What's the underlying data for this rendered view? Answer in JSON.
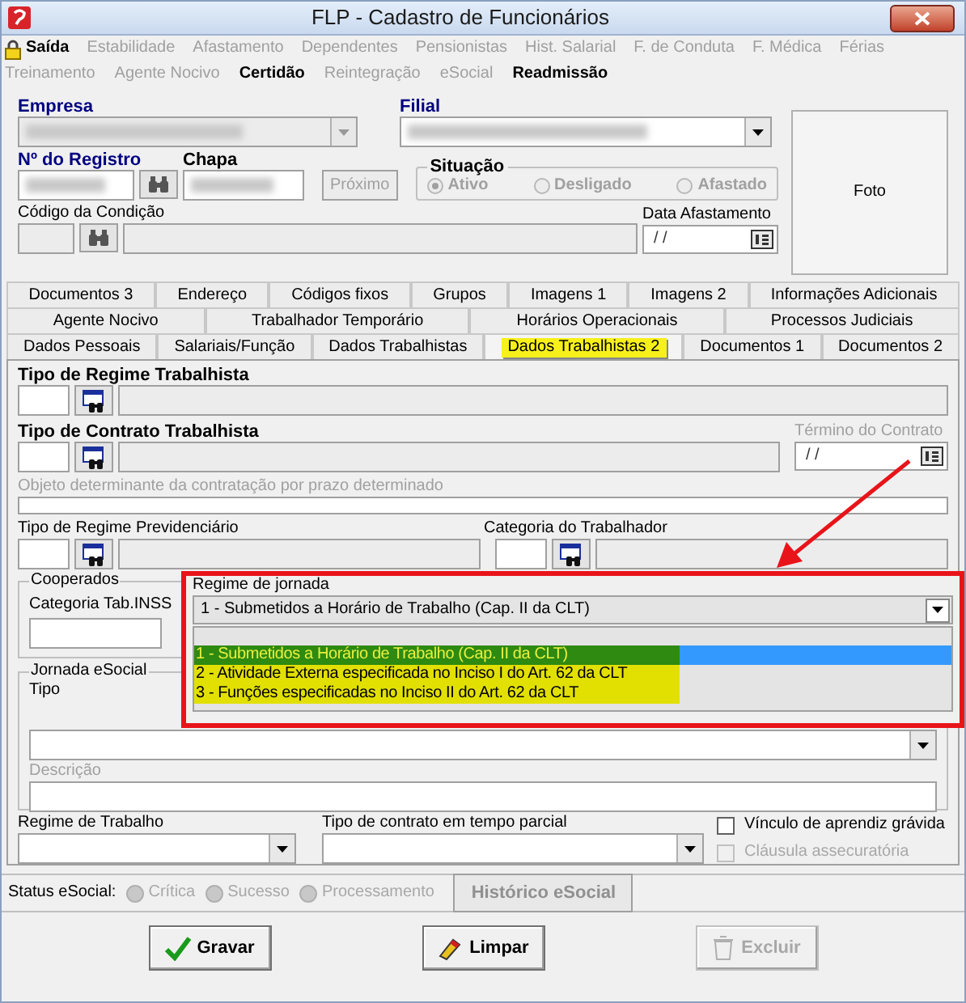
{
  "window": {
    "title": "FLP - Cadastro de Funcionários"
  },
  "menu": {
    "rows": [
      {
        "items": [
          {
            "label": "Saída",
            "disabled": false
          },
          {
            "label": "Estabilidade",
            "disabled": true
          },
          {
            "label": "Afastamento",
            "disabled": true
          },
          {
            "label": "Dependentes",
            "disabled": true
          },
          {
            "label": "Pensionistas",
            "disabled": true
          },
          {
            "label": "Hist. Salarial",
            "disabled": true
          },
          {
            "label": "F. de Conduta",
            "disabled": true
          },
          {
            "label": "F. Médica",
            "disabled": true
          },
          {
            "label": "Férias",
            "disabled": true
          }
        ]
      },
      {
        "items": [
          {
            "label": "Treinamento",
            "disabled": true
          },
          {
            "label": "Agente Nocivo",
            "disabled": true
          },
          {
            "label": "Certidão",
            "disabled": false
          },
          {
            "label": "Reintegração",
            "disabled": true
          },
          {
            "label": "eSocial",
            "disabled": true
          },
          {
            "label": "Readmissão",
            "disabled": false
          }
        ]
      }
    ]
  },
  "header": {
    "empresa": {
      "label": "Empresa"
    },
    "filial": {
      "label": "Filial"
    },
    "registro": {
      "label": "Nº do Registro"
    },
    "chapa": {
      "label": "Chapa"
    },
    "next_button": {
      "label": "Próximo",
      "disabled": true
    },
    "situacao": {
      "label": "Situação",
      "options": [
        {
          "label": "Ativo",
          "selected": true,
          "disabled": true
        },
        {
          "label": "Desligado",
          "selected": false,
          "disabled": true
        },
        {
          "label": "Afastado",
          "selected": false,
          "disabled": true
        }
      ]
    },
    "codigo_condicao": {
      "label": "Código da Condição"
    },
    "data_afastamento": {
      "label": "Data Afastamento",
      "value": "/ /"
    },
    "photo": {
      "label": "Foto"
    }
  },
  "tabs": {
    "rows": [
      {
        "items": [
          {
            "label": "Documentos 3",
            "selected": false
          },
          {
            "label": "Endereço",
            "selected": false
          },
          {
            "label": "Códigos fixos",
            "selected": false
          },
          {
            "label": "Grupos",
            "selected": false
          },
          {
            "label": "Imagens 1",
            "selected": false
          },
          {
            "label": "Imagens 2",
            "selected": false
          },
          {
            "label": "Informações Adicionais",
            "selected": false
          }
        ]
      },
      {
        "items": [
          {
            "label": "Agente Nocivo",
            "selected": false
          },
          {
            "label": "Trabalhador Temporário",
            "selected": false
          },
          {
            "label": "Horários Operacionais",
            "selected": false
          },
          {
            "label": "Processos Judiciais",
            "selected": false
          }
        ]
      },
      {
        "items": [
          {
            "label": "Dados Pessoais",
            "selected": false
          },
          {
            "label": "Salariais/Função",
            "selected": false
          },
          {
            "label": "Dados Trabalhistas",
            "selected": false
          },
          {
            "label": "Dados Trabalhistas 2",
            "selected": true
          },
          {
            "label": "Documentos 1",
            "selected": false
          },
          {
            "label": "Documentos 2",
            "selected": false
          }
        ]
      }
    ]
  },
  "regime_trabalhista": {
    "label": "Tipo de Regime Trabalhista"
  },
  "contrato_trabalhista": {
    "label": "Tipo de Contrato Trabalhista"
  },
  "termino_contrato": {
    "label": "Término do Contrato",
    "value": "/ /",
    "disabled": true
  },
  "objeto": {
    "label": "Objeto determinante da contratação por prazo determinado",
    "disabled": true
  },
  "regime_previdenciario": {
    "label": "Tipo de Regime Previdenciário"
  },
  "categoria_trabalhador": {
    "label": "Categoria do Trabalhador"
  },
  "cooperados": {
    "title": "Cooperados",
    "label": "Categoria Tab.INSS"
  },
  "regime_jornada": {
    "label": "Regime de jornada",
    "value": "1 - Submetidos a Horário de Trabalho (Cap. II da CLT)",
    "expanded": true,
    "options": [
      {
        "label": "1 - Submetidos a Horário de Trabalho (Cap. II da CLT)",
        "selected": true
      },
      {
        "label": "2 - Atividade Externa especificada no Inciso I do Art. 62 da CLT",
        "selected": false
      },
      {
        "label": "3 - Funções especificadas no Inciso II do Art. 62 da CLT",
        "selected": false
      }
    ]
  },
  "jornada_esocial": {
    "title": "Jornada eSocial",
    "tipo_label": "Tipo",
    "descricao": {
      "label": "Descrição",
      "disabled": true
    }
  },
  "regime_trabalho": {
    "label": "Regime de Trabalho"
  },
  "tempo_parcial": {
    "label": "Tipo de contrato em tempo parcial"
  },
  "checkboxes": [
    {
      "label": "Vínculo de aprendiz grávida",
      "checked": false,
      "disabled": false
    },
    {
      "label": "Cláusula assecuratória",
      "checked": false,
      "disabled": true
    }
  ],
  "status_esocial": {
    "label": "Status eSocial:",
    "indicators": [
      {
        "label": "Crítica",
        "disabled": true
      },
      {
        "label": "Sucesso",
        "disabled": true
      },
      {
        "label": "Processamento",
        "disabled": true
      }
    ],
    "history_button": {
      "label": "Histórico eSocial",
      "disabled": true
    }
  },
  "actions": [
    {
      "label": "Gravar",
      "kind": "save",
      "disabled": false
    },
    {
      "label": "Limpar",
      "kind": "clear",
      "disabled": false
    },
    {
      "label": "Excluir",
      "kind": "delete",
      "disabled": true
    }
  ]
}
